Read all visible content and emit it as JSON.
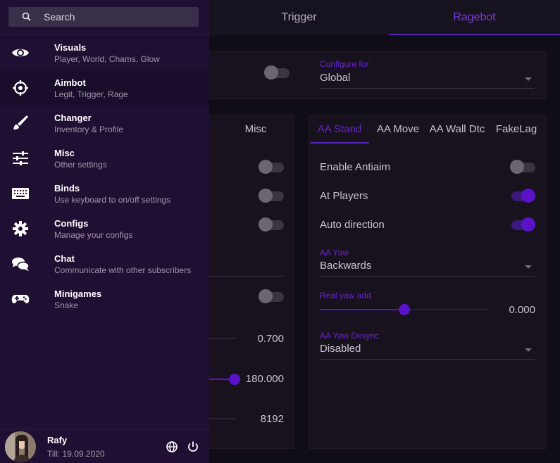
{
  "tabs": {
    "trigger": "Trigger",
    "ragebot": "Ragebot"
  },
  "configure": {
    "label": "Configure for",
    "value": "Global"
  },
  "left_panel": {
    "tab_misc": "Misc",
    "values": [
      "0.700",
      "180.000",
      "8192"
    ]
  },
  "right_panel": {
    "tabs": [
      "AA Stand",
      "AA Move",
      "AA Wall Dtc",
      "FakeLag"
    ],
    "enable_antiaim": "Enable Antiaim",
    "at_players": "At Players",
    "auto_direction": "Auto direction",
    "aa_yaw_label": "AA Yaw",
    "aa_yaw_value": "Backwards",
    "real_yaw_label": "Real yaw add",
    "real_yaw_value": "0.000",
    "real_yaw_fraction": 0.5,
    "aa_yaw_desync_label": "AA Yaw Desync",
    "aa_yaw_desync_value": "Disabled",
    "toggles": {
      "enable_antiaim": false,
      "at_players": true,
      "auto_direction": true
    }
  },
  "sidebar": {
    "search_placeholder": "Search",
    "items": [
      {
        "title": "Visuals",
        "sub": "Player, World, Chams, Glow",
        "icon": "eye-icon"
      },
      {
        "title": "Aimbot",
        "sub": "Legit, Trigger, Rage",
        "icon": "crosshair-icon"
      },
      {
        "title": "Changer",
        "sub": "Inventory & Profile",
        "icon": "brush-icon"
      },
      {
        "title": "Misc",
        "sub": "Other settings",
        "icon": "sliders-icon"
      },
      {
        "title": "Binds",
        "sub": "Use keyboard to on/off settings",
        "icon": "keyboard-icon"
      },
      {
        "title": "Configs",
        "sub": "Manage your configs",
        "icon": "gear-icon"
      },
      {
        "title": "Chat",
        "sub": "Communicate with other subscribers",
        "icon": "chat-icon"
      },
      {
        "title": "Minigames",
        "sub": "Snake",
        "icon": "gamepad-icon"
      }
    ],
    "active_item": "Aimbot"
  },
  "user": {
    "name": "Rafy",
    "till": "Till: 19.09.2020"
  },
  "colors": {
    "accent": "#5a12c8",
    "sidebar_bg": "#1f0f33",
    "content_bg": "#110d17"
  }
}
